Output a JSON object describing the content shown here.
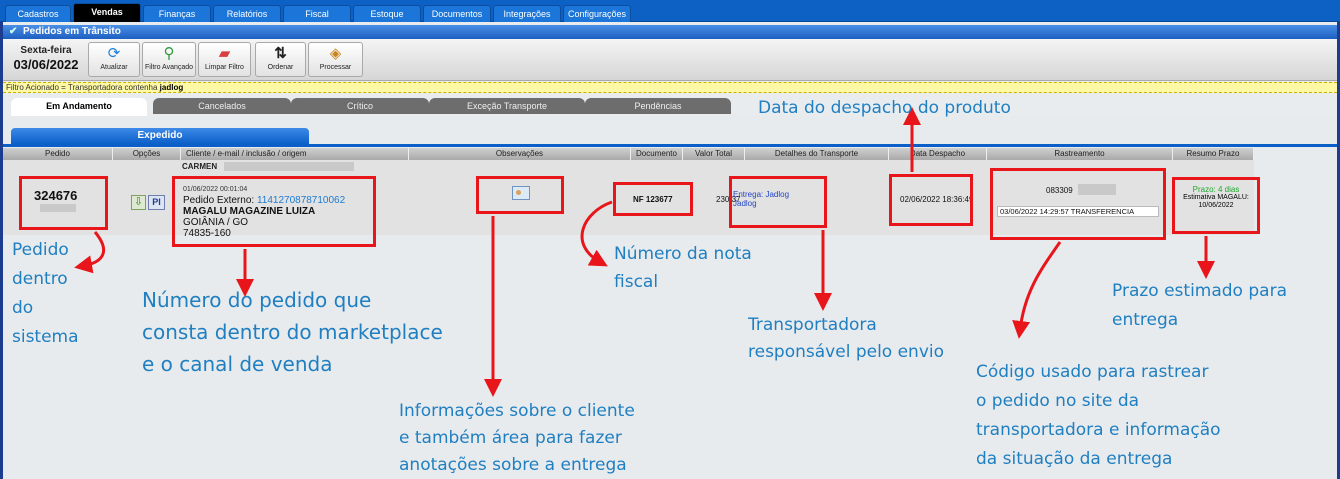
{
  "nav": {
    "tabs": [
      "Cadastros",
      "Vendas",
      "Finanças",
      "Relatórios",
      "Fiscal",
      "Estoque",
      "Documentos",
      "Integrações",
      "Configurações"
    ],
    "active": "Vendas"
  },
  "section": {
    "title": "Pedidos em Trânsito"
  },
  "toolbar": {
    "day": "Sexta-feira",
    "date": "03/06/2022",
    "buttons": [
      {
        "label": "Atualizar",
        "icon": "refresh-icon"
      },
      {
        "label": "Filtro Avançado",
        "icon": "advanced-filter-icon"
      },
      {
        "label": "Limpar Filtro",
        "icon": "eraser-icon"
      },
      {
        "label": "Ordenar",
        "icon": "sort-icon"
      },
      {
        "label": "Processar",
        "icon": "process-box-icon"
      }
    ]
  },
  "filter": {
    "prefix": "Filtro Acionado = Transportadora contenha ",
    "value": "jadlog"
  },
  "status_tabs": [
    "Em Andamento",
    "Cancelados",
    "Crítico",
    "Exceção Transporte",
    "Pendências"
  ],
  "subtab": "Expedido",
  "columns": [
    "Pedido",
    "Opções",
    "Cliente / e-mail / inclusão / origem",
    "Observações",
    "Documento",
    "Valor Total",
    "Detalhes do Transporte",
    "Data Despacho",
    "Rastreamento",
    "Resumo Prazo"
  ],
  "order": {
    "customer_name": "CARMEN",
    "id": "324676",
    "pi_label": "PI",
    "inclusion": "01/06/2022 00:01:04",
    "external_label": "Pedido Externo: ",
    "external_id": "1141270878710062",
    "store": "MAGALU MAGAZINE LUIZA",
    "city": "GOIÂNIA / GO",
    "zip": "74835-160",
    "document": "NF 123677",
    "total": "230,37",
    "transport_line1": "Entrega: Jadlog",
    "transport_line2": "Jadlog",
    "dispatch_date": "02/06/2022 18:36:49",
    "tracking_code": "083309",
    "tracking_status": "03/06/2022 14:29:57 TRANSFERENCIA",
    "prazo": "Prazo: 4 dias",
    "estimate_label": "Estimativa MAGALU:",
    "estimate_date": "10/06/2022"
  },
  "annotations": {
    "dispatch": "Data do despacho do produto",
    "pedido": [
      "Pedido",
      "dentro",
      "do",
      "sistema"
    ],
    "marketplace": [
      "Número do pedido que",
      "consta dentro do marketplace",
      "e o canal de venda"
    ],
    "nf": [
      "Número da nota",
      "fiscal"
    ],
    "cliente": [
      "Informações sobre o cliente",
      "e também área para fazer",
      "anotações sobre a entrega"
    ],
    "transportadora": [
      "Transportadora",
      "responsável pelo envio"
    ],
    "prazo": [
      "Prazo estimado para",
      "entrega"
    ],
    "rastreio": [
      "Código usado para rastrear",
      "o pedido no site da",
      "transportadora e informação",
      "da situação da entrega"
    ]
  },
  "colors": {
    "nav_blue": "#0d61c4",
    "annotation_red": "#e8161b",
    "annotation_text": "#1f7fc0",
    "prazo_green": "#1aaa2a"
  }
}
